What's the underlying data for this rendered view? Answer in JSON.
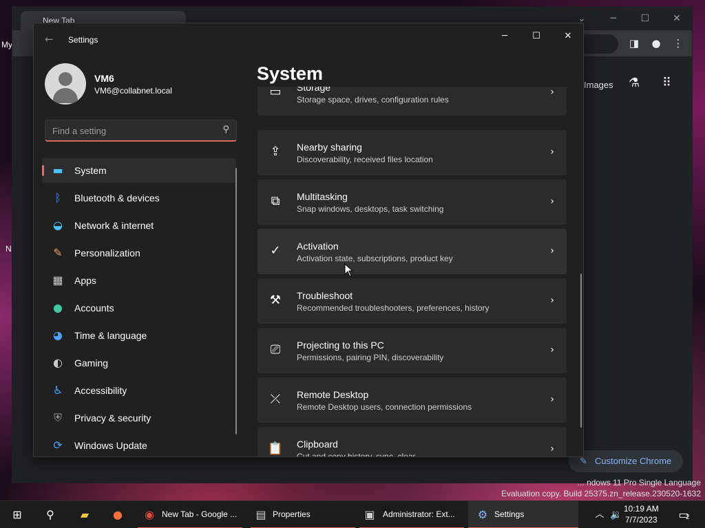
{
  "desktop": {
    "left_text": "My",
    "left_text2": "N",
    "watermark_line1": "... ndows 11 Pro Single Language",
    "watermark_line2": "Evaluation copy. Build 25375.zn_release.230520-1632"
  },
  "chrome": {
    "tab_title": "New Tab",
    "images_link": "Images",
    "customize_label": "Customize Chrome"
  },
  "settings": {
    "app_title": "Settings",
    "user": {
      "name": "VM6",
      "email": "VM6@collabnet.local"
    },
    "search": {
      "placeholder": "Find a setting"
    },
    "page_title": "System",
    "nav": [
      {
        "label": "System",
        "icon": "monitor-icon",
        "color": "#4cc2ff"
      },
      {
        "label": "Bluetooth & devices",
        "icon": "bluetooth-icon",
        "color": "#2f8fff"
      },
      {
        "label": "Network & internet",
        "icon": "wifi-icon",
        "color": "#4cc2ff"
      },
      {
        "label": "Personalization",
        "icon": "brush-icon",
        "color": "#e8a06a"
      },
      {
        "label": "Apps",
        "icon": "apps-icon",
        "color": "#c9c9c9"
      },
      {
        "label": "Accounts",
        "icon": "person-icon",
        "color": "#3ec7a0"
      },
      {
        "label": "Time & language",
        "icon": "globe-clock-icon",
        "color": "#4aa3ff"
      },
      {
        "label": "Gaming",
        "icon": "gamepad-icon",
        "color": "#c9c9c9"
      },
      {
        "label": "Accessibility",
        "icon": "accessibility-icon",
        "color": "#4aa3ff"
      },
      {
        "label": "Privacy & security",
        "icon": "shield-icon",
        "color": "#9a9a9a"
      },
      {
        "label": "Windows Update",
        "icon": "update-icon",
        "color": "#4aa3ff"
      }
    ],
    "cards": [
      {
        "title": "Storage",
        "desc": "Storage space, drives, configuration rules",
        "icon": "storage-icon"
      },
      {
        "title": "Nearby sharing",
        "desc": "Discoverability, received files location",
        "icon": "share-icon"
      },
      {
        "title": "Multitasking",
        "desc": "Snap windows, desktops, task switching",
        "icon": "multitasking-icon"
      },
      {
        "title": "Activation",
        "desc": "Activation state, subscriptions, product key",
        "icon": "checkmark-circle-icon"
      },
      {
        "title": "Troubleshoot",
        "desc": "Recommended troubleshooters, preferences, history",
        "icon": "wrench-icon"
      },
      {
        "title": "Projecting to this PC",
        "desc": "Permissions, pairing PIN, discoverability",
        "icon": "projector-icon"
      },
      {
        "title": "Remote Desktop",
        "desc": "Remote Desktop users, connection permissions",
        "icon": "remote-desktop-icon"
      },
      {
        "title": "Clipboard",
        "desc": "Cut and copy history, sync, clear",
        "icon": "clipboard-icon"
      }
    ]
  },
  "taskbar": {
    "items": [
      {
        "label": "New Tab - Google ...",
        "icon": "chrome-icon"
      },
      {
        "label": "Properties",
        "icon": "properties-icon"
      },
      {
        "label": "Administrator: Ext...",
        "icon": "terminal-icon"
      },
      {
        "label": "Settings",
        "icon": "settings-gear-icon"
      }
    ],
    "time": "10:19 AM",
    "date": "7/7/2023",
    "notification_count": "2"
  }
}
